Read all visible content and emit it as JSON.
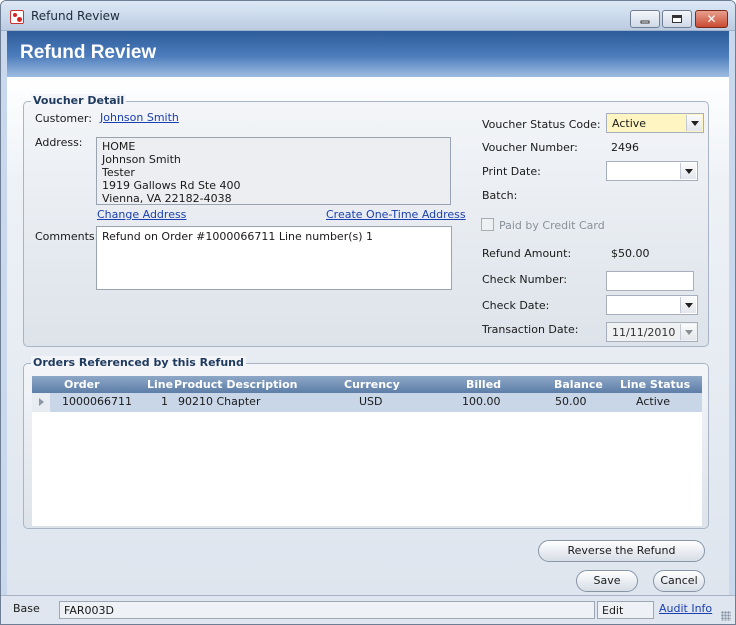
{
  "window": {
    "title": "Refund Review",
    "header_title": "Refund Review",
    "app_icon": "app-logo-icon",
    "close_glyph": "✕"
  },
  "voucher": {
    "group_title": "Voucher Detail",
    "customer_label": "Customer:",
    "customer_name": "Johnson Smith",
    "address_label": "Address:",
    "address_lines": [
      "HOME",
      "Johnson Smith",
      "Tester",
      "1919 Gallows Rd Ste 400",
      "Vienna, VA 22182-4038"
    ],
    "change_address": "Change Address",
    "create_one_time_address": "Create One-Time Address",
    "comments_label": "Comments:",
    "comments": "Refund on Order #1000066711 Line number(s) 1",
    "status_code_label": "Voucher Status Code:",
    "status_code_value": "Active",
    "voucher_number_label": "Voucher Number:",
    "voucher_number": "2496",
    "print_date_label": "Print Date:",
    "print_date": "",
    "batch_label": "Batch:",
    "batch": "",
    "paid_by_credit_card_label": "Paid by Credit Card",
    "paid_by_credit_card": false,
    "refund_amount_label": "Refund Amount:",
    "refund_amount": "$50.00",
    "check_number_label": "Check Number:",
    "check_number": "",
    "check_date_label": "Check Date:",
    "check_date": "",
    "transaction_date_label": "Transaction Date:",
    "transaction_date": "11/11/2010",
    "accent_color": "#fff5c2"
  },
  "orders": {
    "group_title": "Orders Referenced by this Refund",
    "columns": [
      "Order",
      "Line",
      "Product Description",
      "Currency",
      "Billed",
      "Balance",
      "Line Status"
    ],
    "rows": [
      {
        "order": "1000066711",
        "line": "1",
        "product": "90210 Chapter",
        "currency": "USD",
        "billed": "100.00",
        "balance": "50.00",
        "status": "Active"
      }
    ]
  },
  "buttons": {
    "reverse_refund": "Reverse the Refund",
    "save": "Save",
    "cancel": "Cancel"
  },
  "statusbar": {
    "base": "Base",
    "form_code": "FAR003D",
    "mode": "Edit",
    "audit_info": "Audit Info"
  }
}
